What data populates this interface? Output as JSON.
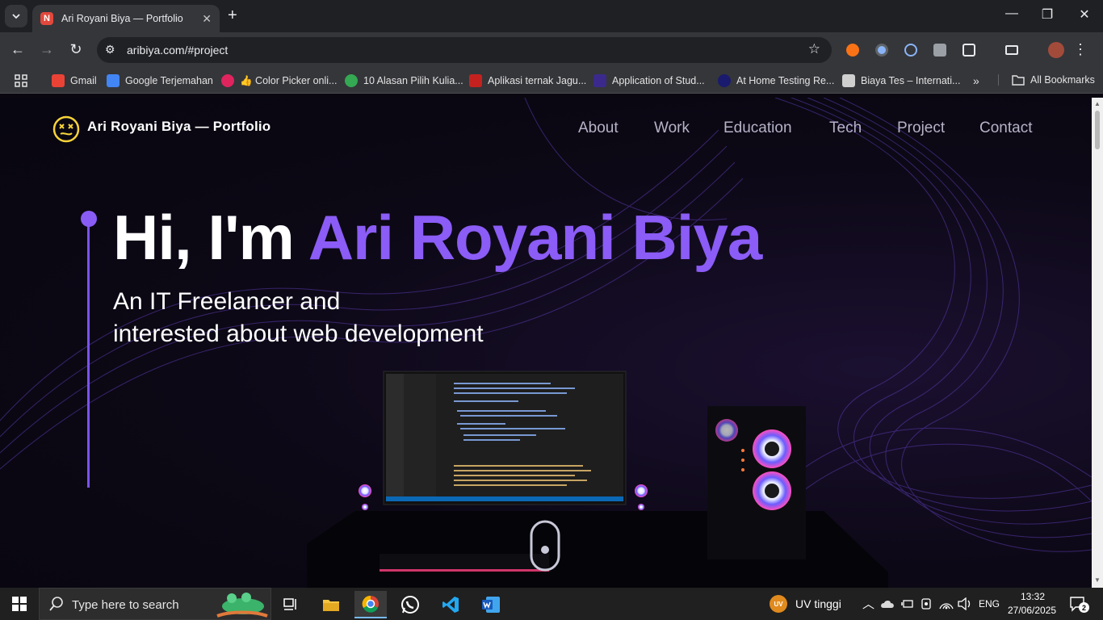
{
  "browser": {
    "tab_title": "Ari Royani Biya — Portfolio",
    "tab_favicon_letter": "N",
    "url": "aribiya.com/#project",
    "bookmarks": [
      {
        "label": "Gmail",
        "color": "#ea4335"
      },
      {
        "label": "Google Terjemahan",
        "color": "#4285f4"
      },
      {
        "label": "👍 Color Picker onli...",
        "color": "#e0245e"
      },
      {
        "label": "10 Alasan Pilih Kulia...",
        "color": "#34a853"
      },
      {
        "label": "Aplikasi ternak Jagu...",
        "color": "#c5221f"
      },
      {
        "label": "Application of Stud...",
        "color": "#3b2a8c"
      },
      {
        "label": "At Home Testing Re...",
        "color": "#1a1a6e"
      },
      {
        "label": "Biaya Tes – Internati...",
        "color": "#cfcfcf"
      }
    ],
    "all_bookmarks": "All Bookmarks"
  },
  "site": {
    "brand": "Ari Royani Biya — Portfolio",
    "nav": [
      "About",
      "Work",
      "Education",
      "Tech",
      "Project",
      "Contact"
    ],
    "hero": {
      "greeting": "Hi, I'm ",
      "name": "Ari Royani Biya",
      "subtitle_line1": "An IT Freelancer and",
      "subtitle_line2": "interested about web development"
    },
    "accent_color": "#8b5cf6"
  },
  "taskbar": {
    "search_placeholder": "Type here to search",
    "weather": "UV tinggi",
    "weather_badge": "UV",
    "language": "ENG",
    "time": "13:32",
    "date": "27/06/2025",
    "notifications": "2"
  }
}
